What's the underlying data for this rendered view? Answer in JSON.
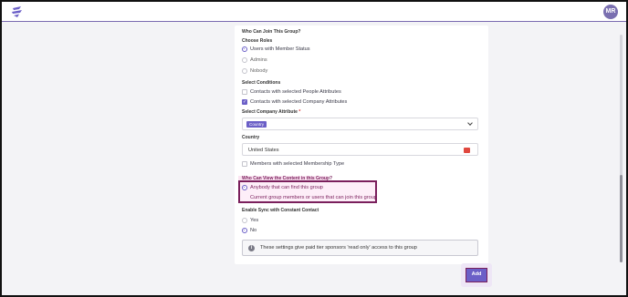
{
  "header": {
    "logo_icon": "lightning-stripes-icon",
    "avatar_initials": "MR",
    "avatar_color": "#7a6fb0"
  },
  "form": {
    "who_can_join_heading": "Who Can Join This Group?",
    "choose_roles_label": "Choose Roles",
    "roles": [
      {
        "label": "Users with Member Status",
        "selected": true
      },
      {
        "label": "Admins",
        "selected": false
      },
      {
        "label": "Nobody",
        "selected": false
      }
    ],
    "select_conditions_label": "Select Conditions",
    "conditions": [
      {
        "label": "Contacts with selected People Attributes",
        "checked": false
      },
      {
        "label": "Contacts with selected Company Attributes",
        "checked": true
      }
    ],
    "company_attribute_label": "Select Company Attribute",
    "required_marker": "*",
    "company_attribute_tag": "Country",
    "country_label": "Country",
    "country_value": "United States",
    "membership_type_label": "Members with selected Membership Type",
    "membership_type_checked": false,
    "who_can_view_heading": "Who Can View the Content in this Group?",
    "view_options": [
      {
        "label": "Anybody that can find this group",
        "selected": true
      },
      {
        "label": "Current group members or users that can join this group",
        "selected": false
      }
    ],
    "sync_heading": "Enable Sync with Constant Contact",
    "sync_options": [
      {
        "label": "Yes",
        "selected": false
      },
      {
        "label": "No",
        "selected": true
      }
    ],
    "notice_text": "These settings give paid tier sponsors 'read only' access to this group",
    "add_button_label": "Add"
  },
  "colors": {
    "accent": "#6b5fc7",
    "highlight_border": "#7a1f5c",
    "flag_icon": "#e0483e"
  }
}
